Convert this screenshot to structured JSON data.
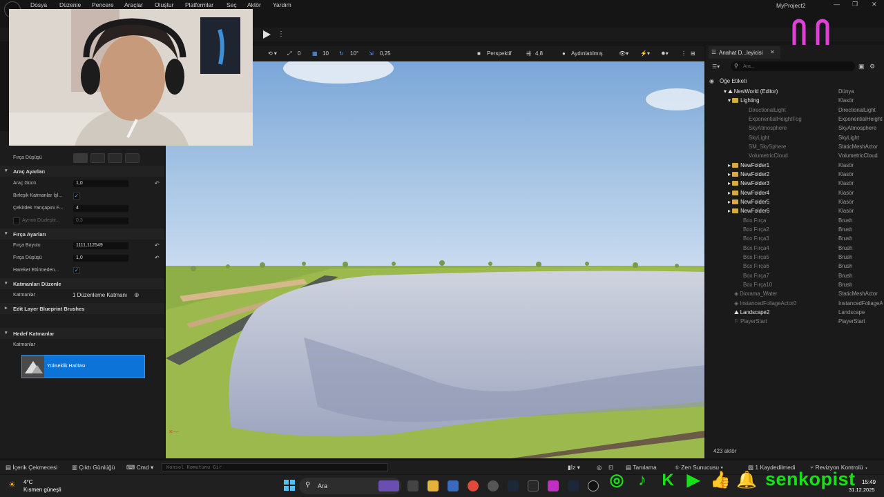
{
  "menu": {
    "items": [
      "Dosya",
      "Düzenle",
      "Pencere",
      "Araçlar",
      "Oluştur",
      "Platformlar",
      "Seç",
      "Aktör",
      "Yardım"
    ],
    "project_name": "MyProject2"
  },
  "viewport_toolbar": {
    "rotate_snap_count": "0",
    "grid_snap": "10",
    "angle_snap": "10°",
    "scale_snap": "0,25",
    "view_mode": "Perspektif",
    "camera_speed": "4,8",
    "lighting_mode": "Aydınlatılmış"
  },
  "left_panel": {
    "brush_falloff_label": "Fırça Düşüşü",
    "tool_settings": {
      "header": "Araç Ayarları",
      "tool_strength_label": "Araç Gücü",
      "tool_strength_value": "1,0",
      "combined_layers_label": "Birleşik Katmanlar İşl...",
      "kernel_radius_label": "Çekirdek Yarıçapını F...",
      "kernel_radius_value": "4",
      "detail_smooth_label": "Ayrıntı Düzleştir...",
      "detail_smooth_value": "0,3"
    },
    "brush_settings": {
      "header": "Fırça Ayarları",
      "brush_size_label": "Fırça Boyutu",
      "brush_size_value": "1111,112549",
      "brush_falloff_label": "Fırça Düşüşü",
      "brush_falloff_value": "1,0",
      "use_clay_label": "Hareket Ettirmeden..."
    },
    "edit_layers": {
      "header": "Katmanları Düzenle",
      "layers_label": "Katmanlar",
      "layers_value": "1 Düzenleme Katmanı"
    },
    "blueprint_brushes_header": "Edit Layer Blueprint Brushes",
    "target_layers": {
      "header": "Hedef Katmanlar",
      "layers_label": "Katmanlar",
      "heightmap_label": "Yükseklik Haritası"
    }
  },
  "outliner": {
    "tab_title": "Anahat D...leyicisi",
    "search_placeholder": "Ara...",
    "column_label": "Öğe Etiketi",
    "rows": [
      {
        "name": "NewWorld (Editor)",
        "type": "Dünya"
      },
      {
        "name": "Lighting",
        "type": "Klasör"
      },
      {
        "name": "DirectionalLight",
        "type": "DirectionalLight"
      },
      {
        "name": "ExponentialHeightFog",
        "type": "ExponentialHeightFog"
      },
      {
        "name": "SkyAtmosphere",
        "type": "SkyAtmosphere"
      },
      {
        "name": "SkyLight",
        "type": "SkyLight"
      },
      {
        "name": "SM_SkySphere",
        "type": "StaticMeshActor"
      },
      {
        "name": "VolumetricCloud",
        "type": "VolumetricCloud"
      },
      {
        "name": "NewFolder1",
        "type": "Klasör"
      },
      {
        "name": "NewFolder2",
        "type": "Klasör"
      },
      {
        "name": "NewFolder3",
        "type": "Klasör"
      },
      {
        "name": "NewFolder4",
        "type": "Klasör"
      },
      {
        "name": "NewFolder5",
        "type": "Klasör"
      },
      {
        "name": "NewFolder6",
        "type": "Klasör"
      },
      {
        "name": "Box Fırça",
        "type": "Brush"
      },
      {
        "name": "Box Fırça2",
        "type": "Brush"
      },
      {
        "name": "Box Fırça3",
        "type": "Brush"
      },
      {
        "name": "Box Fırça4",
        "type": "Brush"
      },
      {
        "name": "Box Fırça5",
        "type": "Brush"
      },
      {
        "name": "Box Fırça6",
        "type": "Brush"
      },
      {
        "name": "Box Fırça7",
        "type": "Brush"
      },
      {
        "name": "Box Fırça10",
        "type": "Brush"
      },
      {
        "name": "Diorama_Water",
        "type": "StaticMeshActor"
      },
      {
        "name": "InstancedFoliageActor0",
        "type": "InstancedFoliageActor"
      },
      {
        "name": "Landscape2",
        "type": "Landscape"
      },
      {
        "name": "PlayerStart",
        "type": "PlayerStart"
      }
    ],
    "actor_count": "423 aktör"
  },
  "statusbar": {
    "content_drawer": "İçerik Çekmecesi",
    "output_log": "Çıktı Günlüğü",
    "cmd": "Cmd",
    "console_placeholder": "Konsol Komutunu Gir",
    "trace": "İz",
    "derived_data": "Tanılama",
    "zen_server": "Zen Sunucusu",
    "saved": "1 Kaydedilmedi",
    "revision_control": "Revizyon Kontrolü"
  },
  "taskbar": {
    "weather_temp": "4°C",
    "weather_desc": "Kısmen güneşli",
    "search_label": "Ara",
    "time": "15:49",
    "date": "31.12.2025"
  },
  "overlay": {
    "brand": "senkopist",
    "accent_color": "#16e016",
    "smiley_color": "#e040d8"
  }
}
